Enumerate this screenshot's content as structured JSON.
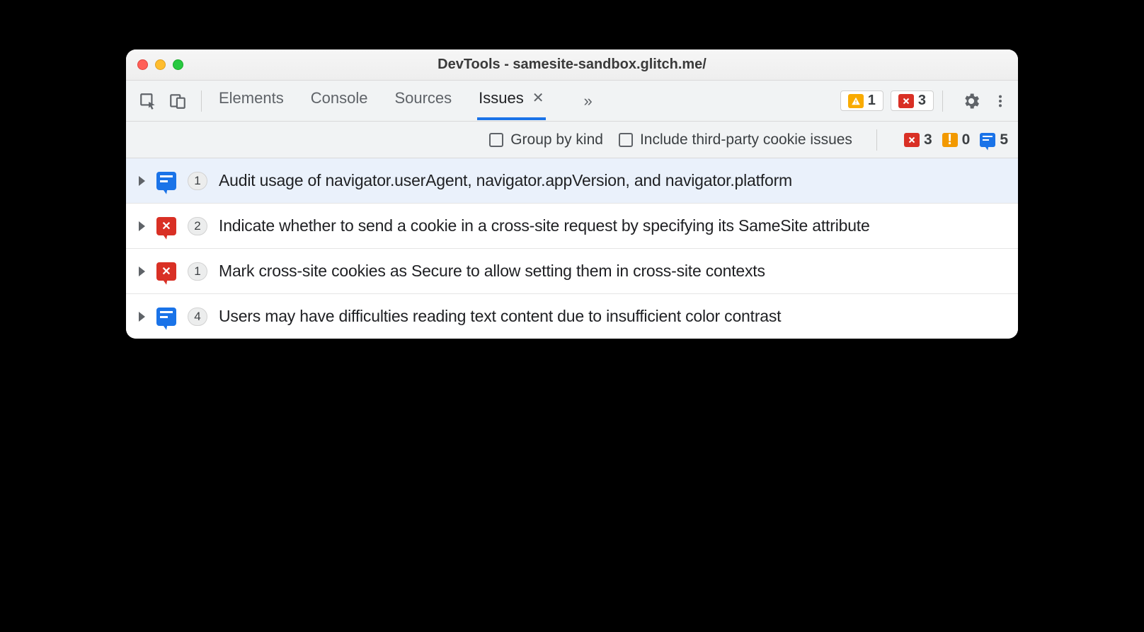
{
  "window": {
    "title": "DevTools - samesite-sandbox.glitch.me/"
  },
  "toolbar": {
    "tabs": [
      {
        "label": "Elements",
        "active": false
      },
      {
        "label": "Console",
        "active": false
      },
      {
        "label": "Sources",
        "active": false
      },
      {
        "label": "Issues",
        "active": true,
        "closable": true
      }
    ],
    "warning_count": "1",
    "error_count": "3"
  },
  "filterbar": {
    "group_by_kind_label": "Group by kind",
    "include_third_party_label": "Include third-party cookie issues",
    "counts": {
      "errors": "3",
      "breaking": "0",
      "info": "5"
    }
  },
  "issues": [
    {
      "kind": "info",
      "count": "1",
      "text": "Audit usage of navigator.userAgent, navigator.appVersion, and navigator.platform",
      "selected": true
    },
    {
      "kind": "error",
      "count": "2",
      "text": "Indicate whether to send a cookie in a cross-site request by specifying its SameSite attribute",
      "selected": false
    },
    {
      "kind": "error",
      "count": "1",
      "text": "Mark cross-site cookies as Secure to allow setting them in cross-site contexts",
      "selected": false
    },
    {
      "kind": "info",
      "count": "4",
      "text": "Users may have difficulties reading text content due to insufficient color contrast",
      "selected": false
    }
  ]
}
